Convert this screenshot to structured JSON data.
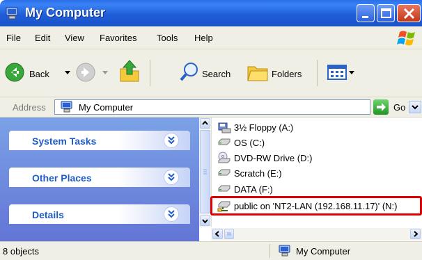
{
  "window": {
    "title": "My Computer"
  },
  "menubar": {
    "items": [
      "File",
      "Edit",
      "View",
      "Favorites",
      "Tools",
      "Help"
    ]
  },
  "toolbar": {
    "back_label": "Back",
    "search_label": "Search",
    "folders_label": "Folders"
  },
  "addressbar": {
    "label": "Address",
    "value": "My Computer",
    "go_label": "Go"
  },
  "taskpane": {
    "sections": [
      "System Tasks",
      "Other Places",
      "Details"
    ]
  },
  "files": [
    {
      "label": "3½ Floppy (A:)",
      "icon": "floppy-drive-icon"
    },
    {
      "label": "OS (C:)",
      "icon": "hard-drive-icon"
    },
    {
      "label": "DVD-RW Drive (D:)",
      "icon": "dvd-drive-icon"
    },
    {
      "label": "Scratch (E:)",
      "icon": "hard-drive-icon"
    },
    {
      "label": "DATA (F:)",
      "icon": "hard-drive-icon"
    },
    {
      "label": "public on 'NT2-LAN (192.168.11.17)' (N:)",
      "icon": "network-drive-icon"
    }
  ],
  "statusbar": {
    "left": "8 objects",
    "right": "My Computer"
  },
  "colors": {
    "title_blue": "#1f5ed8",
    "task_blue": "#215dc6",
    "highlight_red": "#e00000"
  }
}
